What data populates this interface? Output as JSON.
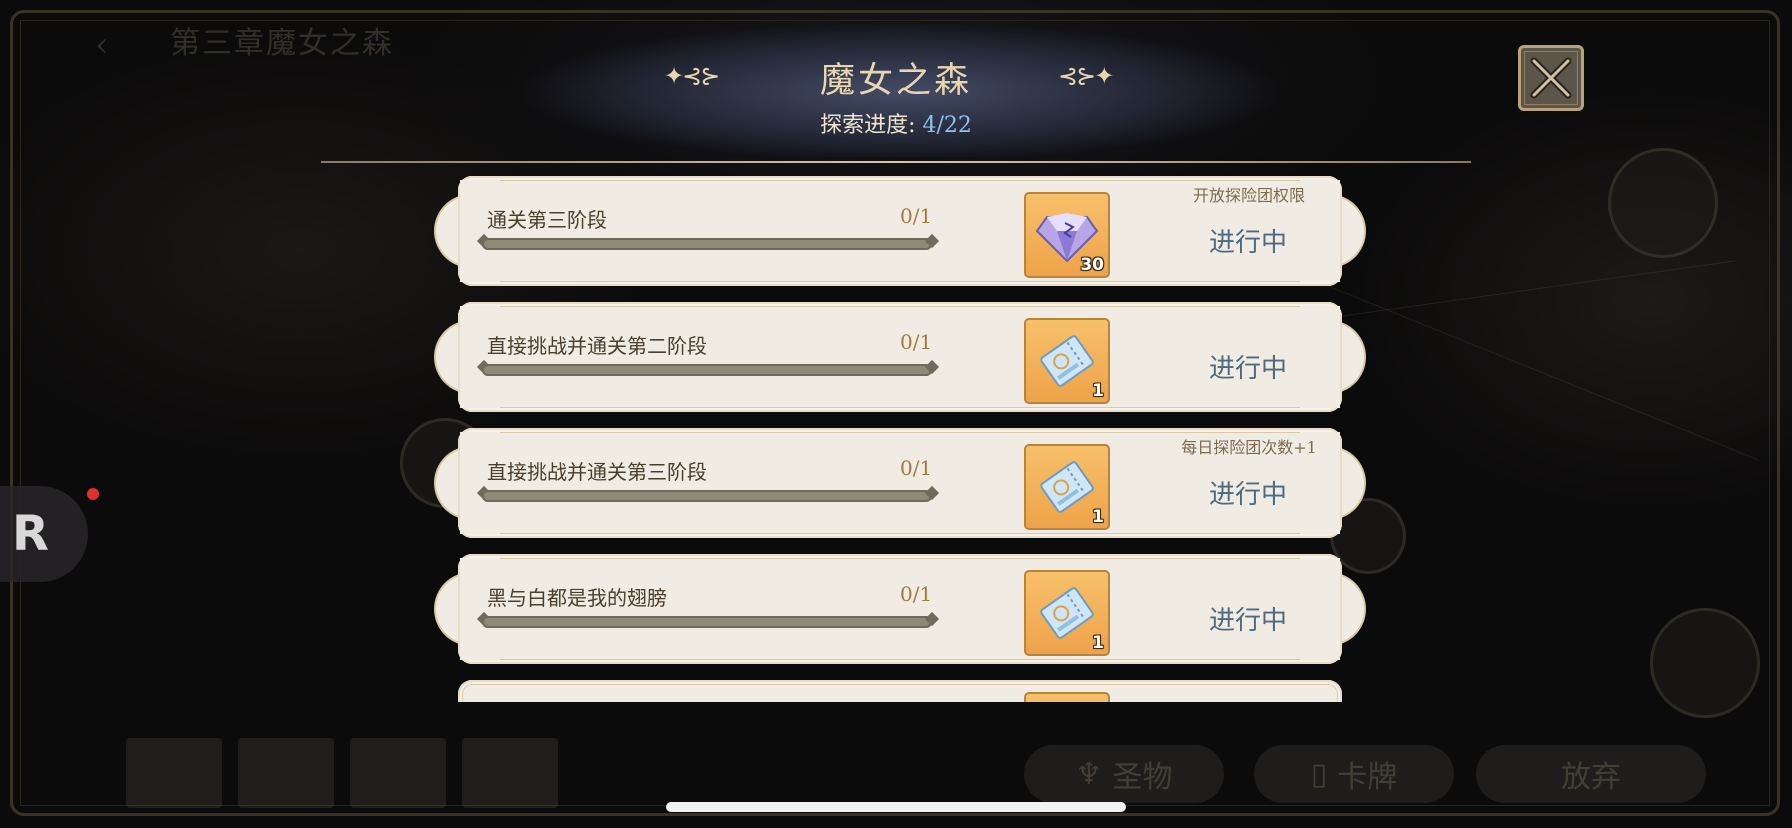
{
  "background": {
    "chapter_title": "第三章魔女之森",
    "chapter_sub": "",
    "quest_hint": "",
    "bottom_buttons": {
      "relic": "圣物",
      "cards": "卡牌",
      "abandon": "放弃"
    }
  },
  "panel": {
    "title": "魔女之森",
    "progress_label": "探索进度: ",
    "progress_value": "4/22",
    "close_label": "close"
  },
  "tasks": [
    {
      "name": "通关第三阶段",
      "count": "0/1",
      "progress": 0,
      "reward_icon": "crystal-icon",
      "reward_qty": "30",
      "status": "进行中",
      "note": "开放探险团权限"
    },
    {
      "name": "直接挑战并通关第二阶段",
      "count": "0/1",
      "progress": 0,
      "reward_icon": "ticket-icon",
      "reward_qty": "1",
      "status": "进行中",
      "note": ""
    },
    {
      "name": "直接挑战并通关第三阶段",
      "count": "0/1",
      "progress": 0,
      "reward_icon": "ticket-icon",
      "reward_qty": "1",
      "status": "进行中",
      "note": "每日探险团次数+1"
    },
    {
      "name": "黑与白都是我的翅膀",
      "count": "0/1",
      "progress": 0,
      "reward_icon": "ticket-icon",
      "reward_qty": "1",
      "status": "进行中",
      "note": ""
    }
  ],
  "colors": {
    "title": "#e7d6ae",
    "progress_value": "#8cc4f0",
    "status": "#4e6a80",
    "card_bg": "#f1ece3",
    "reward_bg": "#f7c06a",
    "badge_dot": "#e0302e"
  },
  "overlay": {
    "badge_letter": "R"
  }
}
